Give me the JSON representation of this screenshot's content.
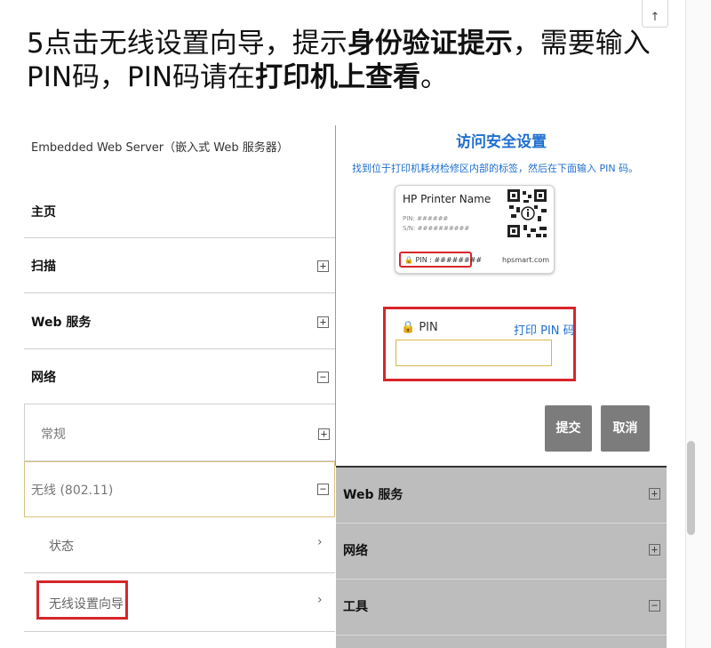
{
  "article": {
    "step": "5点击无线设置向导，提示",
    "bold1": "身份验证提示",
    "mid": "，需要输入PIN码，PIN码请在",
    "bold2": "打印机上查看",
    "end": "。"
  },
  "ews": {
    "title": "Embedded Web Server（嵌入式 Web 服务器）",
    "nav": [
      {
        "label": "主页"
      },
      {
        "label": "扫描",
        "toggle": "+"
      },
      {
        "label": "Web 服务",
        "toggle": "+"
      },
      {
        "label": "网络",
        "toggle": "−"
      },
      {
        "label": "常规",
        "toggle": "+"
      },
      {
        "label": "无线 (802.11)",
        "toggle": "−"
      },
      {
        "label": "状态",
        "chevron": "›"
      },
      {
        "label": "无线设置向导",
        "chevron": "›"
      }
    ]
  },
  "dialog": {
    "title": "访问安全设置",
    "instruction": "找到位于打印机耗材检修区内部的标签，然后在下面输入 PIN 码。",
    "card": {
      "name": "HP Printer Name",
      "pin_line": "PIN: ######",
      "sn_line": "S/N: ##########",
      "pin_highlight": "PIN : ########",
      "url": "hpsmart.com"
    },
    "pin_label": "PIN",
    "print_pin_link": "打印 PIN 码",
    "pin_value": "",
    "submit": "提交",
    "cancel": "取消"
  },
  "right_list": [
    {
      "label": "Web 服务",
      "toggle": "+"
    },
    {
      "label": "网络",
      "toggle": "+"
    },
    {
      "label": "工具",
      "toggle": "−"
    }
  ],
  "scroll": {
    "up_arrow": "↑"
  },
  "colors": {
    "accent": "#1f6fd0",
    "highlight": "#d7262b",
    "button": "#7c7c7c",
    "gray_row": "#bdbdbd"
  }
}
